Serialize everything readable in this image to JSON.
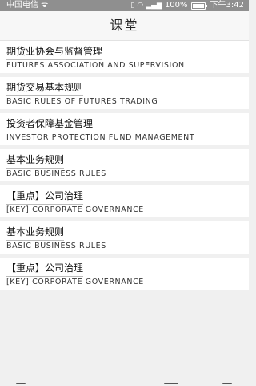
{
  "status_bar": {
    "carrier": "中国电信 ᯤ",
    "battery_text": "100%",
    "battery_level": 1.0,
    "time": "下午3:42"
  },
  "header": {
    "title": "课堂"
  },
  "courses": [
    {
      "zh": "期货业协会与监督管理",
      "en": "FUTURES ASSOCIATION AND SUPERVISION"
    },
    {
      "zh": "期货交易基本规则",
      "en": "BASIC RULES OF FUTURES TRADING"
    },
    {
      "zh": "投资者保障基金管理",
      "en": "INVESTOR PROTECTION FUND MANAGEMENT"
    },
    {
      "zh": "基本业务规则",
      "en": "BASIC BUSINESS RULES"
    },
    {
      "zh": "【重点】公司治理",
      "en": "[KEY] CORPORATE GOVERNANCE"
    },
    {
      "zh": "基本业务规则",
      "en": "BASIC BUSINESS RULES"
    },
    {
      "zh": "【重点】公司治理",
      "en": "[KEY] CORPORATE GOVERNANCE"
    }
  ]
}
